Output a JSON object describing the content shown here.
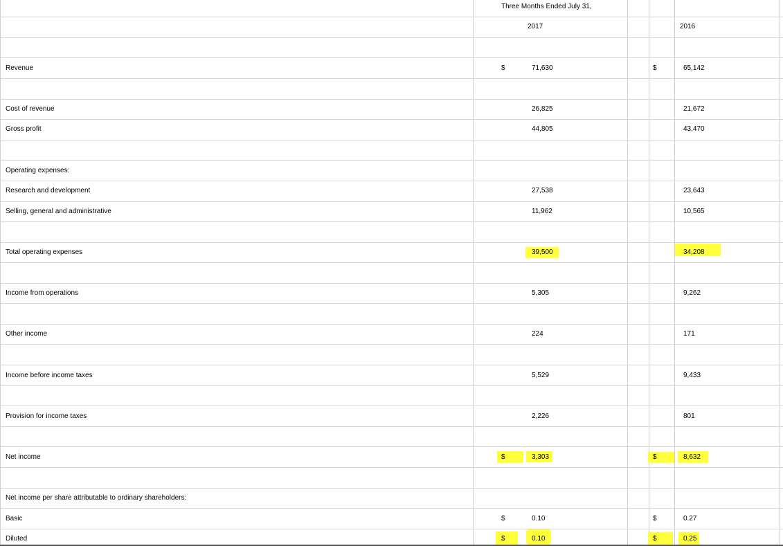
{
  "header": {
    "period": "Three Months Ended July 31,",
    "year_2017": "2017",
    "year_2016": "2016"
  },
  "rows": [
    {
      "label": "Revenue",
      "dollar2017": "$",
      "v2017": "71,630",
      "dollar2016": "$",
      "v2016": "65,142"
    },
    {
      "label": "Cost of revenue",
      "v2017": "26,825",
      "v2016": "21,672"
    },
    {
      "label": "Gross profit",
      "v2017": "44,805",
      "v2016": "43,470"
    },
    {
      "label": "Operating expenses:"
    },
    {
      "label": "Research and development",
      "v2017": "27,538",
      "v2016": "23,643"
    },
    {
      "label": "Selling, general and administrative",
      "v2017": "11,962",
      "v2016": "10,565"
    },
    {
      "label": "Total operating expenses",
      "v2017": "39,500",
      "v2016": "34,208"
    },
    {
      "label": "Income from operations",
      "v2017": "5,305",
      "v2016": "9,262"
    },
    {
      "label": "Other income",
      "v2017": "224",
      "v2016": "171"
    },
    {
      "label": "Income before income taxes",
      "v2017": "5,529",
      "v2016": "9,433"
    },
    {
      "label": "Provision for income taxes",
      "v2017": "2,226",
      "v2016": "801"
    },
    {
      "label": "Net income",
      "dollar2017": "$",
      "v2017": "3,303",
      "dollar2016": "$",
      "v2016": "8,632"
    },
    {
      "label": "Net income per share attributable to ordinary shareholders:"
    },
    {
      "label": "Basic",
      "dollar2017": "$",
      "v2017": "0.10",
      "dollar2016": "$",
      "v2016": "0.27"
    },
    {
      "label": "Diluted",
      "dollar2017": "$",
      "v2017": "0.10",
      "dollar2016": "$",
      "v2016": "0.25"
    }
  ],
  "highlight_color": "#ffff3c",
  "grid_color": "#d4d4d4"
}
